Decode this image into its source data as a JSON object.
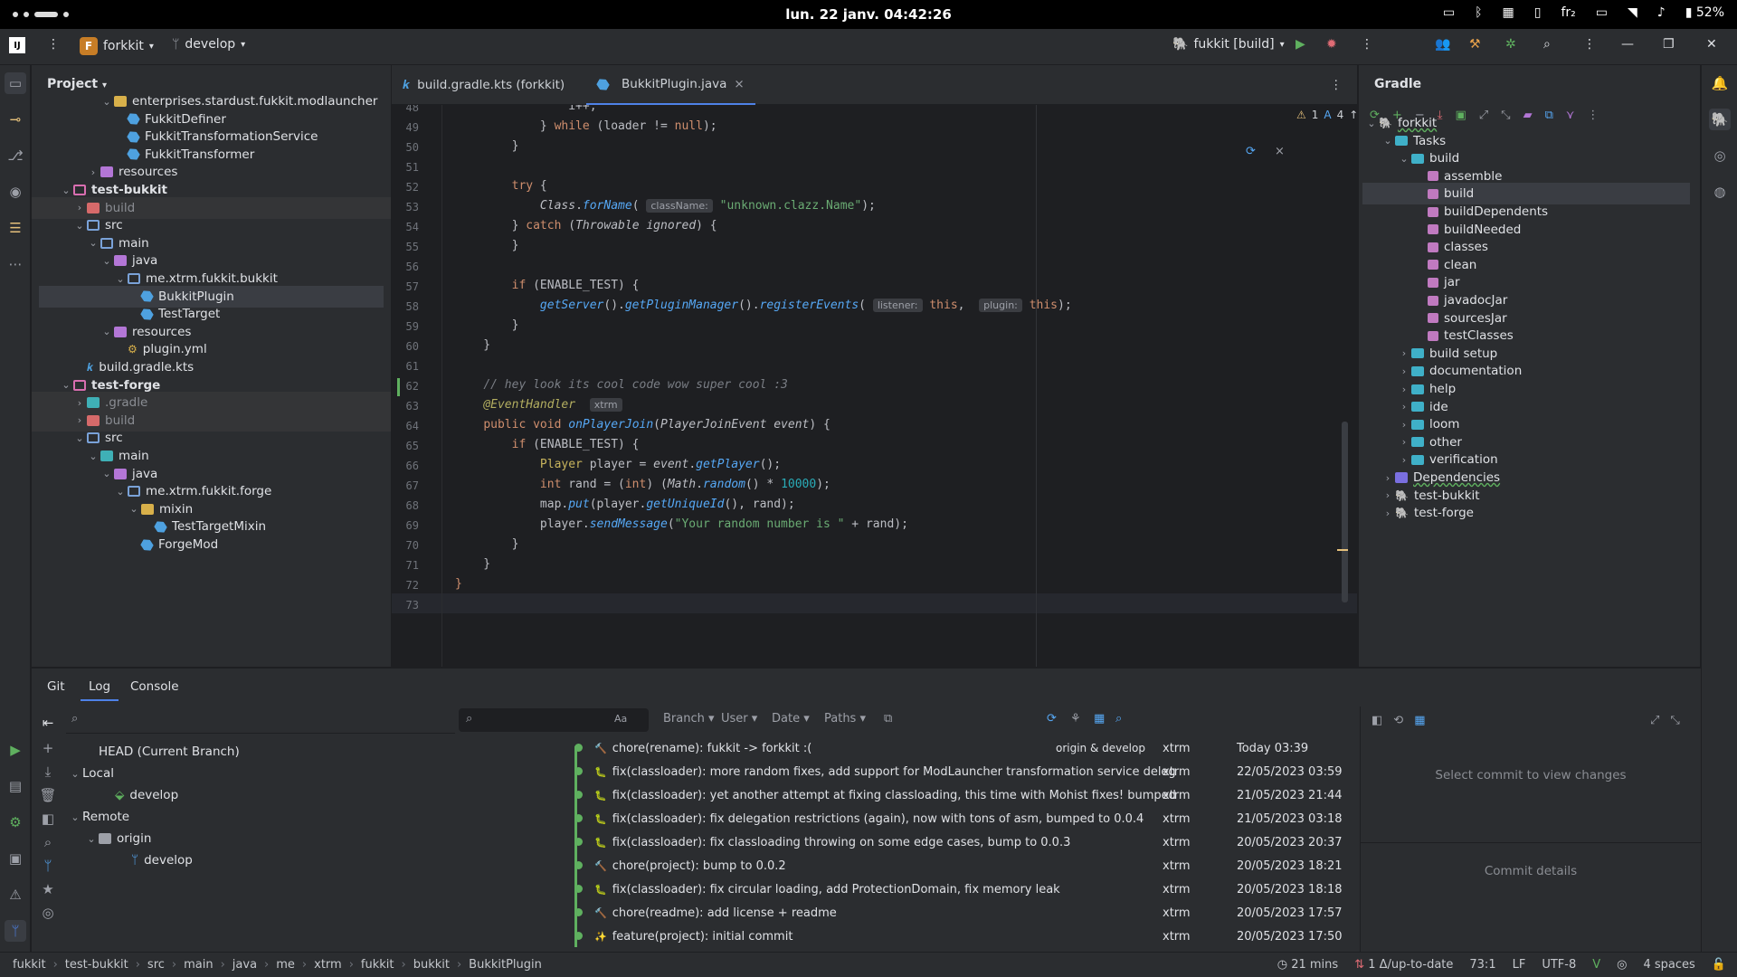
{
  "system_bar": {
    "clock": "lun. 22 janv.  04:42:26",
    "lang": "fr₂",
    "battery": "52%"
  },
  "titlebar": {
    "project_badge": "F",
    "project": "forkkit",
    "branch": "develop",
    "run_config": "fukkit [build]"
  },
  "project_panel": {
    "title": "Project",
    "rows": [
      {
        "label": "enterprises.stardust.fukkit.modlauncher",
        "indent": 5,
        "arrow": "v",
        "icon": "fold-teal-pkg"
      },
      {
        "label": "FukkitDefiner",
        "indent": 6,
        "arrow": "",
        "icon": "java"
      },
      {
        "label": "FukkitTransformationService",
        "indent": 6,
        "arrow": "",
        "icon": "java"
      },
      {
        "label": "FukkitTransformer",
        "indent": 6,
        "arrow": "",
        "icon": "java"
      },
      {
        "label": "resources",
        "indent": 4,
        "arrow": ">",
        "icon": "fold-purple"
      },
      {
        "label": "test-bukkit",
        "indent": 2,
        "arrow": "v",
        "icon": "fold-module",
        "bold": true
      },
      {
        "label": "build",
        "indent": 3,
        "arrow": ">",
        "icon": "fold-red",
        "dim": true,
        "bg": true
      },
      {
        "label": "src",
        "indent": 3,
        "arrow": "v",
        "icon": "fold-blue"
      },
      {
        "label": "main",
        "indent": 4,
        "arrow": "v",
        "icon": "fold-blue"
      },
      {
        "label": "java",
        "indent": 5,
        "arrow": "v",
        "icon": "fold-purple"
      },
      {
        "label": "me.xtrm.fukkit.bukkit",
        "indent": 6,
        "arrow": "v",
        "icon": "fold-blue"
      },
      {
        "label": "BukkitPlugin",
        "indent": 7,
        "arrow": "",
        "icon": "java",
        "selected": true
      },
      {
        "label": "TestTarget",
        "indent": 7,
        "arrow": "",
        "icon": "java"
      },
      {
        "label": "resources",
        "indent": 5,
        "arrow": "v",
        "icon": "fold-purple"
      },
      {
        "label": "plugin.yml",
        "indent": 6,
        "arrow": "",
        "icon": "yml"
      },
      {
        "label": "build.gradle.kts",
        "indent": 3,
        "arrow": "",
        "icon": "gradle"
      },
      {
        "label": "test-forge",
        "indent": 2,
        "arrow": "v",
        "icon": "fold-module",
        "bold": true
      },
      {
        "label": ".gradle",
        "indent": 3,
        "arrow": ">",
        "icon": "fold-teal",
        "dim": true,
        "bg": true
      },
      {
        "label": "build",
        "indent": 3,
        "arrow": ">",
        "icon": "fold-red",
        "dim": true,
        "bg": true
      },
      {
        "label": "src",
        "indent": 3,
        "arrow": "v",
        "icon": "fold-blue"
      },
      {
        "label": "main",
        "indent": 4,
        "arrow": "v",
        "icon": "fold-teal"
      },
      {
        "label": "java",
        "indent": 5,
        "arrow": "v",
        "icon": "fold-purple"
      },
      {
        "label": "me.xtrm.fukkit.forge",
        "indent": 6,
        "arrow": "v",
        "icon": "fold-blue"
      },
      {
        "label": "mixin",
        "indent": 7,
        "arrow": "v",
        "icon": "fold-yellow"
      },
      {
        "label": "TestTargetMixin",
        "indent": 8,
        "arrow": "",
        "icon": "java"
      },
      {
        "label": "ForgeMod",
        "indent": 7,
        "arrow": "",
        "icon": "java"
      }
    ]
  },
  "editor": {
    "tabs": [
      {
        "label": "build.gradle.kts (forkkit)",
        "active": false
      },
      {
        "label": "BukkitPlugin.java",
        "active": true
      }
    ],
    "inspection": {
      "warnings": "1",
      "typos": "4"
    },
    "line_numbers": [
      "48",
      "49",
      "50",
      "51",
      "52",
      "53",
      "54",
      "55",
      "56",
      "57",
      "58",
      "59",
      "60",
      "61",
      "62",
      "63",
      "64",
      "65",
      "66",
      "67",
      "68",
      "69",
      "70",
      "71",
      "72",
      "73"
    ],
    "lines": [
      [
        {
          "t": "                i++;",
          "c": ""
        }
      ],
      [
        {
          "t": "            } ",
          "c": ""
        },
        {
          "t": "while",
          "c": "kw"
        },
        {
          "t": " (loader != ",
          "c": ""
        },
        {
          "t": "null",
          "c": "kw"
        },
        {
          "t": ");",
          "c": ""
        }
      ],
      [
        {
          "t": "        }",
          "c": ""
        }
      ],
      [
        {
          "t": "",
          "c": ""
        }
      ],
      [
        {
          "t": "        ",
          "c": ""
        },
        {
          "t": "try",
          "c": "kw"
        },
        {
          "t": " {",
          "c": ""
        }
      ],
      [
        {
          "t": "            ",
          "c": ""
        },
        {
          "t": "Class",
          "c": "it"
        },
        {
          "t": ".",
          "c": ""
        },
        {
          "t": "forName",
          "c": "mth"
        },
        {
          "t": "( ",
          "c": ""
        },
        {
          "t": "className:",
          "c": "hint"
        },
        {
          "t": " ",
          "c": ""
        },
        {
          "t": "\"unknown.clazz.Name\"",
          "c": "str"
        },
        {
          "t": ");",
          "c": ""
        }
      ],
      [
        {
          "t": "        } ",
          "c": ""
        },
        {
          "t": "catch",
          "c": "kw"
        },
        {
          "t": " (",
          "c": ""
        },
        {
          "t": "Throwable",
          "c": "it"
        },
        {
          "t": " ",
          "c": ""
        },
        {
          "t": "ignored",
          "c": "it"
        },
        {
          "t": ") {",
          "c": ""
        }
      ],
      [
        {
          "t": "        }",
          "c": ""
        }
      ],
      [
        {
          "t": "",
          "c": ""
        }
      ],
      [
        {
          "t": "        ",
          "c": ""
        },
        {
          "t": "if",
          "c": "kw"
        },
        {
          "t": " (ENABLE_TEST) {",
          "c": ""
        }
      ],
      [
        {
          "t": "            ",
          "c": ""
        },
        {
          "t": "getServer",
          "c": "mth"
        },
        {
          "t": "().",
          "c": ""
        },
        {
          "t": "getPluginManager",
          "c": "mth"
        },
        {
          "t": "().",
          "c": ""
        },
        {
          "t": "registerEvents",
          "c": "mth"
        },
        {
          "t": "( ",
          "c": ""
        },
        {
          "t": "listener:",
          "c": "hint"
        },
        {
          "t": " ",
          "c": ""
        },
        {
          "t": "this",
          "c": "kw"
        },
        {
          "t": ",  ",
          "c": ""
        },
        {
          "t": "plugin:",
          "c": "hint"
        },
        {
          "t": " ",
          "c": ""
        },
        {
          "t": "this",
          "c": "kw"
        },
        {
          "t": ");",
          "c": ""
        }
      ],
      [
        {
          "t": "        }",
          "c": ""
        }
      ],
      [
        {
          "t": "    }",
          "c": ""
        }
      ],
      [
        {
          "t": "",
          "c": ""
        }
      ],
      [
        {
          "t": "    ",
          "c": ""
        },
        {
          "t": "// hey look its cool code wow super cool :3",
          "c": "cmt"
        }
      ],
      [
        {
          "t": "    ",
          "c": ""
        },
        {
          "t": "@EventHandler",
          "c": "ann"
        },
        {
          "t": "  ",
          "c": ""
        },
        {
          "t": "xtrm",
          "c": "hint"
        }
      ],
      [
        {
          "t": "    ",
          "c": ""
        },
        {
          "t": "public",
          "c": "kw"
        },
        {
          "t": " ",
          "c": ""
        },
        {
          "t": "void",
          "c": "kw"
        },
        {
          "t": " ",
          "c": ""
        },
        {
          "t": "onPlayerJoin",
          "c": "mth"
        },
        {
          "t": "(",
          "c": ""
        },
        {
          "t": "PlayerJoinEvent",
          "c": "it"
        },
        {
          "t": " ",
          "c": ""
        },
        {
          "t": "event",
          "c": "it"
        },
        {
          "t": ") {",
          "c": ""
        }
      ],
      [
        {
          "t": "        ",
          "c": ""
        },
        {
          "t": "if",
          "c": "kw"
        },
        {
          "t": " (ENABLE_TEST) {",
          "c": ""
        }
      ],
      [
        {
          "t": "            ",
          "c": ""
        },
        {
          "t": "Player",
          "c": "typ"
        },
        {
          "t": " player = ",
          "c": ""
        },
        {
          "t": "event",
          "c": "it"
        },
        {
          "t": ".",
          "c": ""
        },
        {
          "t": "getPlayer",
          "c": "mth"
        },
        {
          "t": "();",
          "c": ""
        }
      ],
      [
        {
          "t": "            ",
          "c": ""
        },
        {
          "t": "int",
          "c": "kw"
        },
        {
          "t": " rand = (",
          "c": ""
        },
        {
          "t": "int",
          "c": "kw"
        },
        {
          "t": ") (",
          "c": ""
        },
        {
          "t": "Math",
          "c": "it"
        },
        {
          "t": ".",
          "c": ""
        },
        {
          "t": "random",
          "c": "mth"
        },
        {
          "t": "() * ",
          "c": ""
        },
        {
          "t": "10000",
          "c": "num"
        },
        {
          "t": ");",
          "c": ""
        }
      ],
      [
        {
          "t": "            map.",
          "c": ""
        },
        {
          "t": "put",
          "c": "mth"
        },
        {
          "t": "(player.",
          "c": ""
        },
        {
          "t": "getUniqueId",
          "c": "mth"
        },
        {
          "t": "(), rand);",
          "c": ""
        }
      ],
      [
        {
          "t": "            player.",
          "c": ""
        },
        {
          "t": "sendMessage",
          "c": "mth"
        },
        {
          "t": "(",
          "c": ""
        },
        {
          "t": "\"Your random number is \"",
          "c": "str"
        },
        {
          "t": " + rand);",
          "c": ""
        }
      ],
      [
        {
          "t": "        }",
          "c": ""
        }
      ],
      [
        {
          "t": "    }",
          "c": ""
        }
      ],
      [
        {
          "t": "}",
          "c": "kw"
        }
      ],
      [
        {
          "t": "",
          "c": ""
        }
      ]
    ]
  },
  "gradle_panel": {
    "title": "Gradle",
    "rows": [
      {
        "label": "forkkit",
        "indent": 0,
        "arrow": "v",
        "icon": "elephant",
        "underline": true
      },
      {
        "label": "Tasks",
        "indent": 1,
        "arrow": "v",
        "icon": "gfold"
      },
      {
        "label": "build",
        "indent": 2,
        "arrow": "v",
        "icon": "gfold"
      },
      {
        "label": "assemble",
        "indent": 3,
        "arrow": "",
        "icon": "task"
      },
      {
        "label": "build",
        "indent": 3,
        "arrow": "",
        "icon": "task",
        "selected": true
      },
      {
        "label": "buildDependents",
        "indent": 3,
        "arrow": "",
        "icon": "task"
      },
      {
        "label": "buildNeeded",
        "indent": 3,
        "arrow": "",
        "icon": "task"
      },
      {
        "label": "classes",
        "indent": 3,
        "arrow": "",
        "icon": "task"
      },
      {
        "label": "clean",
        "indent": 3,
        "arrow": "",
        "icon": "task"
      },
      {
        "label": "jar",
        "indent": 3,
        "arrow": "",
        "icon": "task"
      },
      {
        "label": "javadocJar",
        "indent": 3,
        "arrow": "",
        "icon": "task"
      },
      {
        "label": "sourcesJar",
        "indent": 3,
        "arrow": "",
        "icon": "task"
      },
      {
        "label": "testClasses",
        "indent": 3,
        "arrow": "",
        "icon": "task"
      },
      {
        "label": "build setup",
        "indent": 2,
        "arrow": ">",
        "icon": "gfold"
      },
      {
        "label": "documentation",
        "indent": 2,
        "arrow": ">",
        "icon": "gfold"
      },
      {
        "label": "help",
        "indent": 2,
        "arrow": ">",
        "icon": "gfold"
      },
      {
        "label": "ide",
        "indent": 2,
        "arrow": ">",
        "icon": "gfold"
      },
      {
        "label": "loom",
        "indent": 2,
        "arrow": ">",
        "icon": "gfold"
      },
      {
        "label": "other",
        "indent": 2,
        "arrow": ">",
        "icon": "gfold"
      },
      {
        "label": "verification",
        "indent": 2,
        "arrow": ">",
        "icon": "gfold"
      },
      {
        "label": "Dependencies",
        "indent": 1,
        "arrow": ">",
        "icon": "deps",
        "underline": true
      },
      {
        "label": "test-bukkit",
        "indent": 1,
        "arrow": ">",
        "icon": "elephant"
      },
      {
        "label": "test-forge",
        "indent": 1,
        "arrow": ">",
        "icon": "elephant"
      }
    ]
  },
  "git": {
    "tabs": [
      "Git",
      "Log",
      "Console"
    ],
    "branches": [
      {
        "label": "HEAD (Current Branch)",
        "indent": 1,
        "arrow": ""
      },
      {
        "label": "Local",
        "indent": 0,
        "arrow": "v"
      },
      {
        "label": "develop",
        "indent": 2,
        "arrow": "",
        "icon": "tag"
      },
      {
        "label": "Remote",
        "indent": 0,
        "arrow": "v"
      },
      {
        "label": "origin",
        "indent": 1,
        "arrow": "v",
        "icon": "folder"
      },
      {
        "label": "develop",
        "indent": 3,
        "arrow": "",
        "icon": "branch"
      }
    ],
    "filters": {
      "case": "Aa",
      "branch": "Branch",
      "user": "User",
      "date": "Date",
      "paths": "Paths"
    },
    "commits": [
      {
        "icon": "🔨",
        "message": "chore(rename): fukkit -> forkkit :(",
        "refs": "origin & develop",
        "author": "xtrm",
        "date": "Today 03:39"
      },
      {
        "icon": "🐛",
        "message": "fix(classloader): more random fixes, add support for ModLauncher transformation service deleg",
        "refs": "",
        "author": "xtrm",
        "date": "22/05/2023 03:59"
      },
      {
        "icon": "🐛",
        "message": "fix(classloader): yet another attempt at fixing classloading, this time with Mohist fixes! bumped",
        "refs": "",
        "author": "xtrm",
        "date": "21/05/2023 21:44"
      },
      {
        "icon": "🐛",
        "message": "fix(classloader): fix delegation restrictions (again), now with tons of asm, bumped to 0.0.4",
        "refs": "",
        "author": "xtrm",
        "date": "21/05/2023 03:18"
      },
      {
        "icon": "🐛",
        "message": "fix(classloader): fix classloading throwing on some edge cases, bump to 0.0.3",
        "refs": "",
        "author": "xtrm",
        "date": "20/05/2023 20:37"
      },
      {
        "icon": "🔨",
        "message": "chore(project): bump to 0.0.2",
        "refs": "",
        "author": "xtrm",
        "date": "20/05/2023 18:21"
      },
      {
        "icon": "🐛",
        "message": "fix(classloader): fix circular loading, add ProtectionDomain, fix memory leak",
        "refs": "",
        "author": "xtrm",
        "date": "20/05/2023 18:18"
      },
      {
        "icon": "🔨",
        "message": "chore(readme): add license + readme",
        "refs": "",
        "author": "xtrm",
        "date": "20/05/2023 17:57"
      },
      {
        "icon": "✨",
        "message": "feature(project): initial commit",
        "refs": "",
        "author": "xtrm",
        "date": "20/05/2023 17:50"
      }
    ],
    "empty_changes": "Select commit to view changes",
    "commit_details": "Commit details"
  },
  "statusbar": {
    "breadcrumbs": [
      "fukkit",
      "test-bukkit",
      "src",
      "main",
      "java",
      "me",
      "xtrm",
      "fukkit",
      "bukkit",
      "BukkitPlugin"
    ],
    "time": "21 mins",
    "vcs": "1 Δ/up-to-date",
    "position": "73:1",
    "line_sep": "LF",
    "encoding": "UTF-8",
    "indent": "4 spaces"
  },
  "colors": {
    "accent": "#4e82e8",
    "selection": "#3a3d43",
    "bg": "#1e1f22",
    "panel": "#2b2d30"
  }
}
